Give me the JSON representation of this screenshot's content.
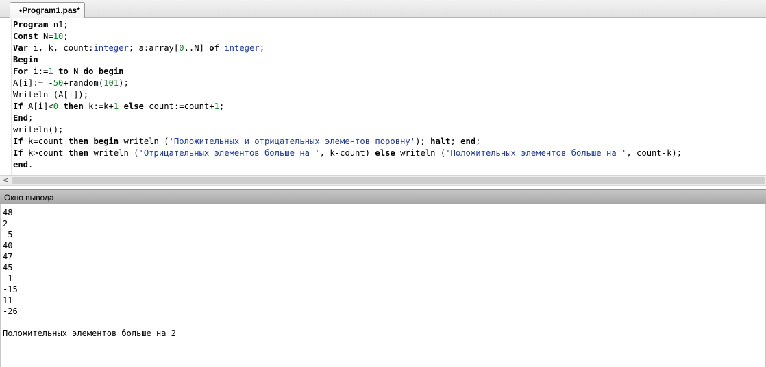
{
  "tab": {
    "label": "•Program1.pas*"
  },
  "editor": {
    "lines": [
      [
        [
          "Program n1;",
          ""
        ]
      ],
      [
        [
          "Const N=",
          ""
        ],
        [
          "10",
          "num"
        ],
        [
          ";",
          ""
        ]
      ],
      [
        [
          "Var i, k, count:",
          ""
        ],
        [
          "integer",
          "ty"
        ],
        [
          "; a:array[",
          ""
        ],
        [
          "0",
          "num"
        ],
        [
          "..N] of ",
          ""
        ],
        [
          "integer",
          "ty"
        ],
        [
          ";",
          ""
        ]
      ],
      [
        [
          "Begin",
          ""
        ]
      ],
      [
        [
          "For i:=",
          ""
        ],
        [
          "1",
          "num"
        ],
        [
          " to N do begin",
          ""
        ]
      ],
      [
        [
          "A[i]:= -",
          ""
        ],
        [
          "50",
          "num"
        ],
        [
          "+random(",
          ""
        ],
        [
          "101",
          "num"
        ],
        [
          ");",
          ""
        ]
      ],
      [
        [
          "Writeln (A[i]);",
          ""
        ]
      ],
      [
        [
          "If A[i]<",
          ""
        ],
        [
          "0",
          "num"
        ],
        [
          " then k:=k+",
          ""
        ],
        [
          "1",
          "num"
        ],
        [
          " else count:=count+",
          ""
        ],
        [
          "1",
          "num"
        ],
        [
          ";",
          ""
        ]
      ],
      [
        [
          "End;",
          ""
        ]
      ],
      [
        [
          "writeln();",
          ""
        ]
      ],
      [
        [
          "If k=count then begin writeln (",
          ""
        ],
        [
          "'Положительных и отрицательных элементов поровну'",
          "str"
        ],
        [
          "); halt; end;",
          ""
        ]
      ],
      [
        [
          "If k>count then writeln (",
          ""
        ],
        [
          "'Отрицательных элементов больше на '",
          "str"
        ],
        [
          ", k-count) else writeln (",
          ""
        ],
        [
          "'Положительных элементов больше на '",
          "str"
        ],
        [
          ", count-k);",
          ""
        ]
      ],
      [
        [
          "end.",
          ""
        ]
      ]
    ]
  },
  "scroll": {
    "left_arrow": "<"
  },
  "output_panel": {
    "title": "Окно вывода",
    "lines": [
      "48",
      "2",
      "-5",
      "40",
      "47",
      "45",
      "-1",
      "-15",
      "11",
      "-26",
      "",
      "Положительных элементов больше на 2"
    ]
  }
}
